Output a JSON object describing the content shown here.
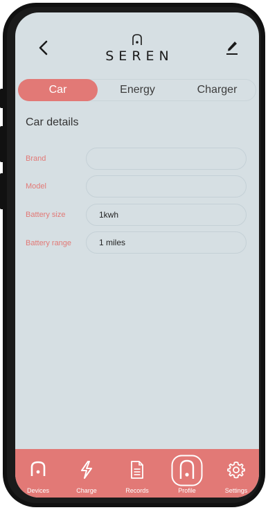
{
  "header": {
    "brand": "SEREN",
    "back_icon": "chevron-left-icon",
    "edit_icon": "pencil-icon"
  },
  "tabs": [
    {
      "label": "Car",
      "active": true
    },
    {
      "label": "Energy",
      "active": false
    },
    {
      "label": "Charger",
      "active": false
    }
  ],
  "section_title": "Car details",
  "fields": [
    {
      "label": "Brand",
      "value": ""
    },
    {
      "label": "Model",
      "value": ""
    },
    {
      "label": "Battery size",
      "value": "1kwh"
    },
    {
      "label": "Battery range",
      "value": "1 miles"
    }
  ],
  "nav": [
    {
      "label": "Devices",
      "icon": "device-icon"
    },
    {
      "label": "Charge",
      "icon": "lightning-icon"
    },
    {
      "label": "Records",
      "icon": "document-icon"
    },
    {
      "label": "Profile",
      "icon": "profile-icon",
      "active": true
    },
    {
      "label": "Settings",
      "icon": "gear-icon"
    }
  ],
  "colors": {
    "accent": "#e27976",
    "background": "#d6dfe3",
    "text": "#333333"
  }
}
